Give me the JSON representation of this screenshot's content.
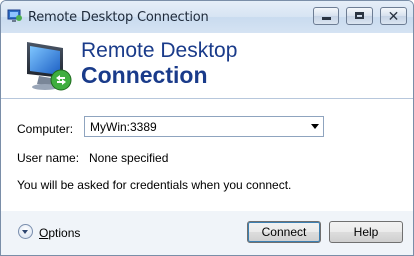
{
  "window": {
    "title": "Remote Desktop Connection",
    "controls": {
      "minimize": "minimize-icon",
      "maximize": "maximize-icon",
      "close": "close-icon"
    },
    "close_glyph": "✕"
  },
  "banner": {
    "line1": "Remote Desktop",
    "line2": "Connection",
    "logo_icon": "remote-desktop-monitor-icon",
    "text_color": "#1a3b8a"
  },
  "form": {
    "computer_label": "Computer:",
    "computer_value": "MyWin:3389",
    "username_label": "User name:",
    "username_value": "None specified",
    "note": "You will be asked for credentials when you connect."
  },
  "footer": {
    "options_label_first": "O",
    "options_label_rest": "ptions",
    "options_icon": "expand-chevron-icon",
    "connect_label": "Connect",
    "help_label": "Help"
  }
}
